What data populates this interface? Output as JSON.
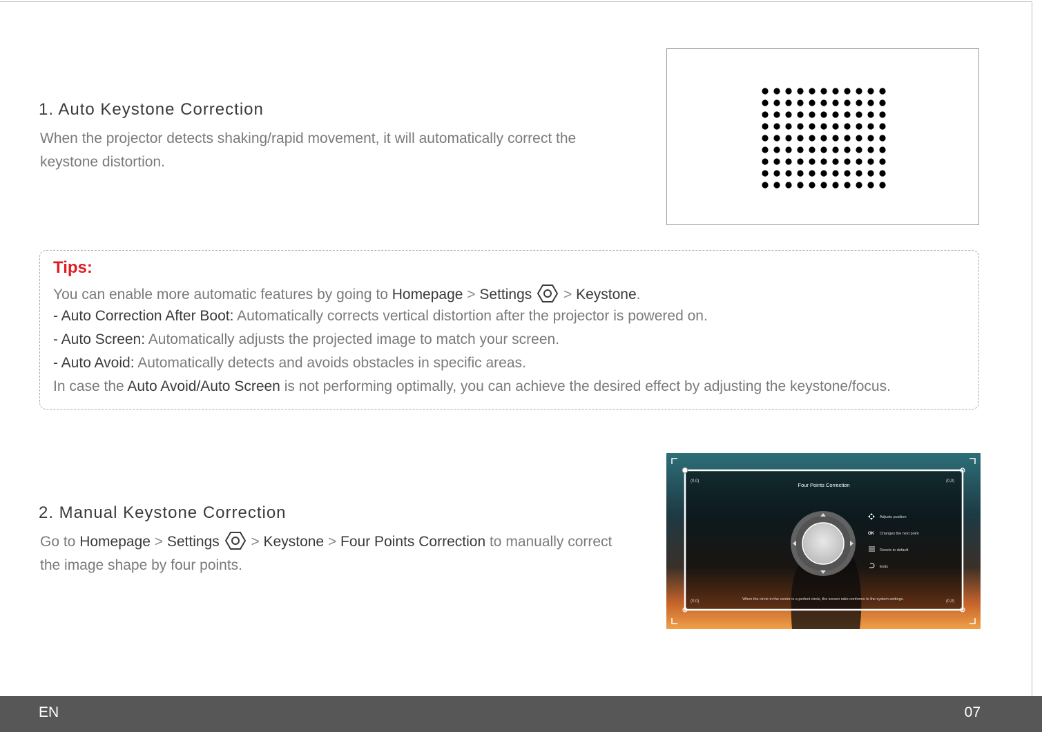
{
  "section1": {
    "title": "1. Auto Keystone Correction",
    "body": "When the projector detects shaking/rapid movement, it will automatically correct the keystone distortion."
  },
  "tips": {
    "title": "Tips:",
    "line1": {
      "prefix": "You can enable more automatic features by going to ",
      "homepage": "Homepage",
      "gt1": " > ",
      "settings": "Settings",
      "gt2": " > ",
      "keystone": "Keystone",
      "suffix": "."
    },
    "line2": {
      "label": "- Auto Correction After Boot:",
      "text": " Automatically corrects vertical distortion after the projector is powered on."
    },
    "line3": {
      "label": "- Auto Screen:",
      "text": " Automatically adjusts the projected image to match your screen."
    },
    "line4": {
      "label": "- Auto Avoid:",
      "text": " Automatically detects and avoids obstacles in specific areas."
    },
    "line5": {
      "prefix": "In case the ",
      "highlight": "Auto Avoid/Auto Screen",
      "suffix": " is not performing optimally, you can achieve the desired effect by adjusting the keystone/focus."
    }
  },
  "section2": {
    "title": "2. Manual Keystone Correction",
    "prefix": "Go to ",
    "homepage": "Homepage",
    "gt1": " > ",
    "settings": "Settings",
    "gt2": " > ",
    "keystone": "Keystone",
    "gt3": " > ",
    "four_points": "Four Points Correction",
    "suffix": " to manually correct the image shape by four points."
  },
  "screenshot": {
    "title": "Four Points Correction",
    "corner_label": "(0,0)",
    "menu": [
      {
        "key": "",
        "icon": "move-arrows-icon",
        "label": "Adjusts position"
      },
      {
        "key": "OK",
        "icon": "",
        "label": "Changes the next point"
      },
      {
        "key": "",
        "icon": "menu-lines-icon",
        "label": "Resets to default"
      },
      {
        "key": "",
        "icon": "back-arrow-icon",
        "label": "Exits"
      }
    ],
    "caption": "When the circle in the center is a perfect circle, the screen ratio conforms to the system settings."
  },
  "footer": {
    "lang": "EN",
    "page": "07"
  },
  "colors": {
    "accent_red": "#e01b22",
    "footer_bg": "#575757"
  }
}
